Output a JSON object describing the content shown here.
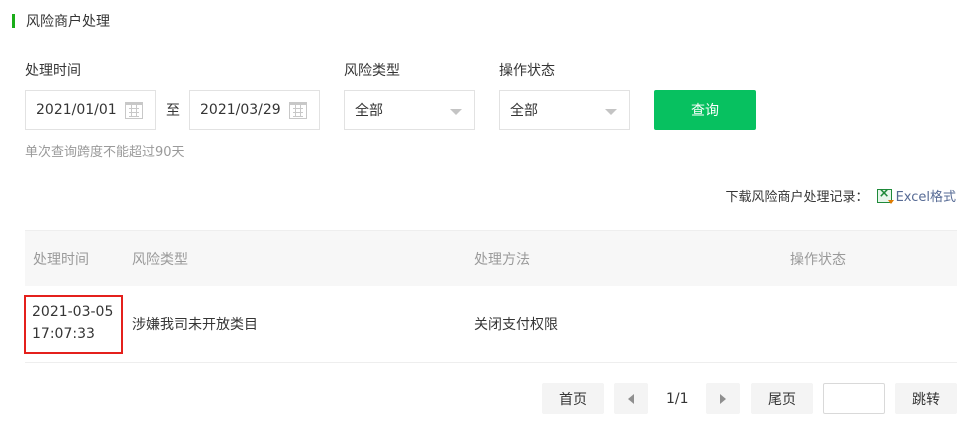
{
  "section": {
    "title": "风险商户处理"
  },
  "filters": {
    "time_label": "处理时间",
    "start_date": "2021/01/01",
    "to_label": "至",
    "end_date": "2021/03/29",
    "risk_type_label": "风险类型",
    "risk_type_value": "全部",
    "status_label": "操作状态",
    "status_value": "全部",
    "query_button": "查询",
    "hint": "单次查询跨度不能超过90天"
  },
  "download": {
    "label": "下载风险商户处理记录：",
    "link": "Excel格式"
  },
  "table": {
    "columns": [
      "处理时间",
      "风险类型",
      "处理方法",
      "操作状态"
    ],
    "rows": [
      {
        "time": "2021-03-05 17:07:33",
        "risk_type": "涉嫌我司未开放类目",
        "method": "关闭支付权限",
        "status": ""
      }
    ]
  },
  "pager": {
    "first": "首页",
    "page_info": "1/1",
    "last": "尾页",
    "jump_value": "",
    "jump": "跳转"
  },
  "colors": {
    "accent": "#07c160",
    "highlight": "#e4201c",
    "link": "#576b95"
  }
}
